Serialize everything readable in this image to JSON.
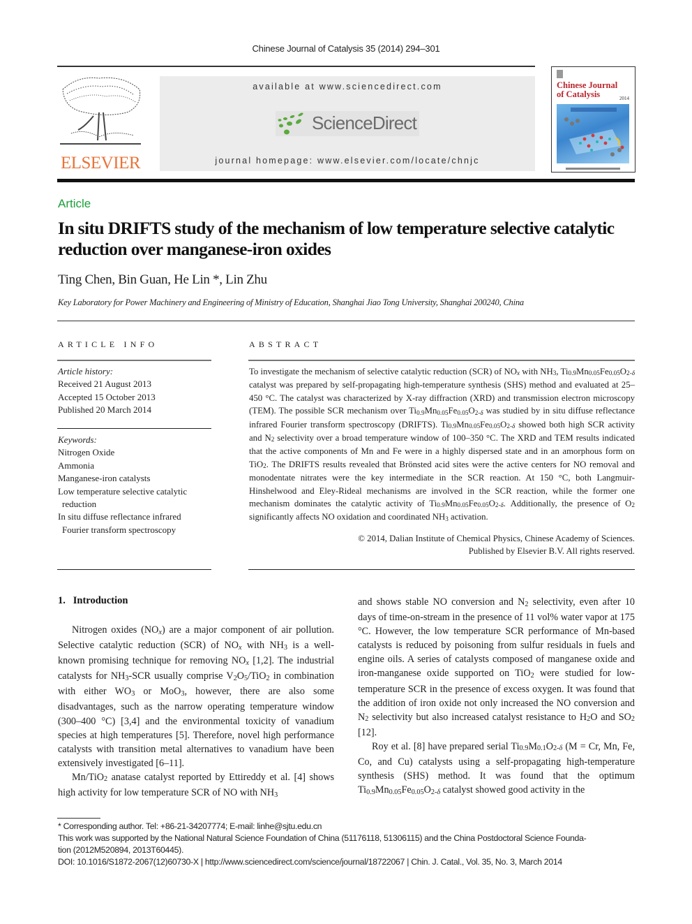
{
  "header": {
    "journal_ref": "Chinese Journal of Catalysis 35 (2014) 294–301",
    "publisher_logo": "ELSEVIER",
    "available_at": "available at www.sciencedirect.com",
    "sd_logo": "ScienceDirect",
    "homepage": "journal homepage: www.elsevier.com/locate/chnjc",
    "cover": {
      "title_line1": "Chinese Journal",
      "title_line2": "of Catalysis",
      "year": "2014"
    },
    "colors": {
      "elsevier_orange": "#e8743b",
      "sd_green": "#5aaa3c",
      "article_green": "#1d9e3a",
      "cover_red": "#b8262d"
    }
  },
  "article": {
    "type": "Article",
    "title": "In situ DRIFTS study of the mechanism of low temperature selective catalytic reduction over manganese-iron oxides",
    "authors": "Ting Chen, Bin Guan, He Lin *, Lin Zhu",
    "affiliation": "Key Laboratory for Power Machinery and Engineering of Ministry of Education, Shanghai Jiao Tong University, Shanghai 200240, China"
  },
  "article_info": {
    "heading": "ARTICLE INFO",
    "history_label": "Article history:",
    "history": [
      "Received 21 August 2013",
      "Accepted 15 October 2013",
      "Published 20 March 2014"
    ],
    "keywords_label": "Keywords:",
    "keywords": [
      "Nitrogen Oxide",
      "Ammonia",
      "Manganese-iron catalysts",
      "Low temperature selective catalytic reduction",
      "In situ diffuse reflectance infrared Fourier transform spectroscopy"
    ]
  },
  "abstract": {
    "heading": "ABSTRACT",
    "text": "To investigate the mechanism of selective catalytic reduction (SCR) of NOx with NH3, Ti0.9Mn0.05Fe0.05O2-δ catalyst was prepared by self-propagating high-temperature synthesis (SHS) method and evaluated at 25–450 °C. The catalyst was characterized by X-ray diffraction (XRD) and transmission electron microscopy (TEM). The possible SCR mechanism over Ti0.9Mn0.05Fe0.05O2-δ was studied by in situ diffuse reflectance infrared Fourier transform spectroscopy (DRIFTS). Ti0.9Mn0.05Fe0.05O2-δ showed both high SCR activity and N2 selectivity over a broad temperature window of 100–350 °C. The XRD and TEM results indicated that the active components of Mn and Fe were in a highly dispersed state and in an amorphous form on TiO2. The DRIFTS results revealed that Brönsted acid sites were the active centers for NO removal and monodentate nitrates were the key intermediate in the SCR reaction. At 150 °C, both Langmuir-Hinshelwood and Eley-Rideal mechanisms are involved in the SCR reaction, while the former one mechanism dominates the catalytic activity of Ti0.9Mn0.05Fe0.05O2-δ. Additionally, the presence of O2 significantly affects NO oxidation and coordinated NH3 activation.",
    "copyright": "© 2014, Dalian Institute of Chemical Physics, Chinese Academy of Sciences.",
    "publisher_rights": "Published by Elsevier B.V. All rights reserved."
  },
  "body": {
    "section_heading": "1.   Introduction",
    "left_paragraphs": [
      "Nitrogen oxides (NOx) are a major component of air pollution. Selective catalytic reduction (SCR) of NOx with NH3 is a well-known promising technique for removing NOx [1,2]. The industrial catalysts for NH3-SCR usually comprise V2O5/TiO2 in combination with either WO3 or MoO3, however, there are also some disadvantages, such as the narrow operating temperature window (300–400 °C) [3,4] and the environmental toxicity of vanadium species at high temperatures [5]. Therefore, novel high performance catalysts with transition metal alternatives to vanadium have been extensively investigated [6–11].",
      "Mn/TiO2 anatase catalyst reported by Ettireddy et al. [4] shows high activity for low temperature SCR of NO with NH3"
    ],
    "right_paragraphs": [
      "and shows stable NO conversion and N2 selectivity, even after 10 days of time-on-stream in the presence of 11 vol% water vapor at 175 °C. However, the low temperature SCR performance of Mn-based catalysts is reduced by poisoning from sulfur residuals in fuels and engine oils. A series of catalysts composed of manganese oxide and iron-manganese oxide supported on TiO2 were studied for low-temperature SCR in the presence of excess oxygen. It was found that the addition of iron oxide not only increased the NO conversion and N2 selectivity but also increased catalyst resistance to H2O and SO2 [12].",
      "Roy et al. [8] have prepared serial Ti0.9M0.1O2-δ (M = Cr, Mn, Fe, Co, and Cu) catalysts using a self-propagating high-temperature synthesis (SHS) method. It was found that the optimum Ti0.9Mn0.05Fe0.05O2-δ catalyst showed good activity in the"
    ]
  },
  "footnotes": {
    "corresponding": "* Corresponding author. Tel: +86-21-34207774; E-mail: linhe@sjtu.edu.cn",
    "funding_line1": "This work was supported by the National Natural Science Foundation of China (51176118, 51306115) and the China Postdoctoral Science Founda-",
    "funding_line2": "tion (2012M520894, 2013T60445).",
    "doi_line": "DOI: 10.1016/S1872-2067(12)60730-X | http://www.sciencedirect.com/science/journal/18722067 | Chin. J. Catal., Vol. 35, No. 3, March 2014"
  }
}
